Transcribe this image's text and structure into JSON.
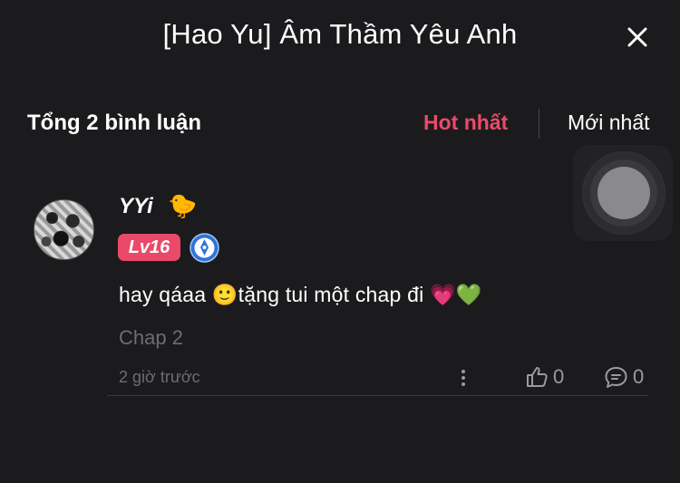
{
  "header": {
    "title": "[Hao Yu] Âm Thầm Yêu Anh",
    "close_icon": "close-icon"
  },
  "comments_bar": {
    "total_label": "Tổng 2 bình luận",
    "sort_hot": "Hot nhất",
    "sort_new": "Mới nhất",
    "active_sort": "Hot nhất",
    "accent_color": "#ec4a6a"
  },
  "floating_button": {
    "icon": "floating-circle-icon"
  },
  "comment": {
    "username": "YYi",
    "username_emoji": "🐤",
    "level": "Lv16",
    "badge_icon": "pen-badge-icon",
    "text": "hay qáaa 🙂tặng tui một chap đi 💗💚",
    "chapter": "Chap 2",
    "time": "2 giờ trước",
    "likes": "0",
    "replies": "0"
  }
}
